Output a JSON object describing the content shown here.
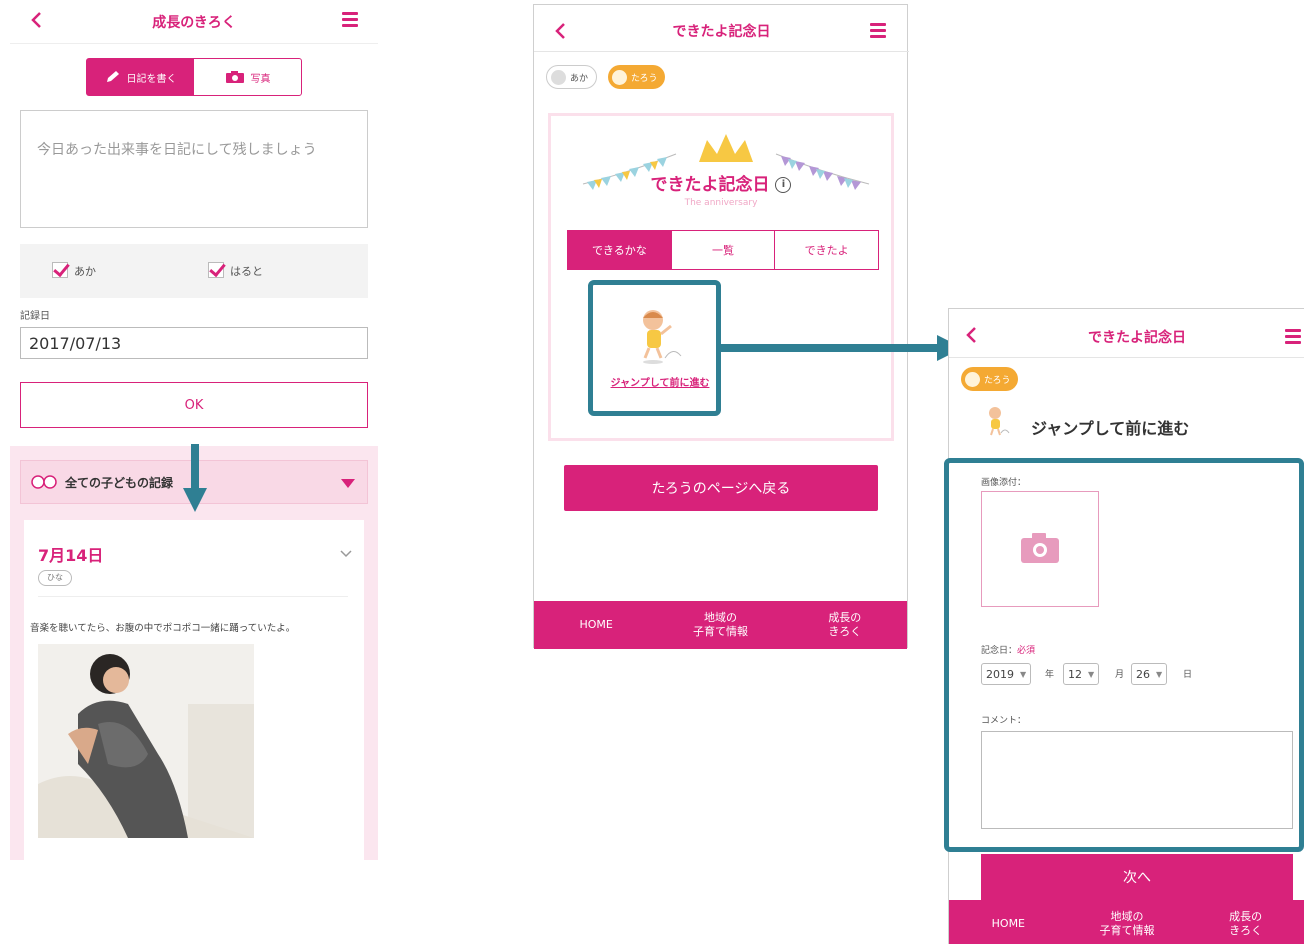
{
  "colors": {
    "accent": "#d8227a",
    "annotation": "#2f7f93",
    "avatar_orange": "#f4a933"
  },
  "screen1": {
    "title": "成長のきろく",
    "tab_diary": "日記を書く",
    "tab_photo": "写真",
    "diary_placeholder": "今日あった出来事を日記にして残しましょう",
    "child_checks": [
      "あか",
      "はると"
    ],
    "date_label": "記録日",
    "date_value": "2017/07/13",
    "ok_label": "OK",
    "all_records_label": "全ての子どもの記録",
    "entry": {
      "date": "7月14日",
      "tag": "ひな",
      "text": "音楽を聴いてたら、お腹の中でポコポコ一緒に踊っていたよ。"
    }
  },
  "screen2": {
    "title": "できたよ記念日",
    "children": [
      "あか",
      "たろう"
    ],
    "hero_title": "できたよ記念日",
    "hero_subtitle": "The anniversary",
    "tabs": [
      "できるかな",
      "一覧",
      "できたよ"
    ],
    "item_label": "ジャンプして前に進む",
    "back_button": "たろうのページへ戻る",
    "tabbar": {
      "home": "HOME",
      "local_1": "地域の",
      "local_2": "子育て情報",
      "growth_1": "成長の",
      "growth_2": "きろく"
    }
  },
  "screen3": {
    "title": "できたよ記念日",
    "child": "たろう",
    "item_title": "ジャンプして前に進む",
    "image_label": "画像添付：",
    "date_label": "記念日：",
    "required": "必須",
    "year": "2019",
    "year_unit": "年",
    "month": "12",
    "month_unit": "月",
    "day": "26",
    "day_unit": "日",
    "comment_label": "コメント：",
    "next_button": "次へ",
    "tabbar": {
      "home": "HOME",
      "local_1": "地域の",
      "local_2": "子育て情報",
      "growth_1": "成長の",
      "growth_2": "きろく"
    }
  }
}
